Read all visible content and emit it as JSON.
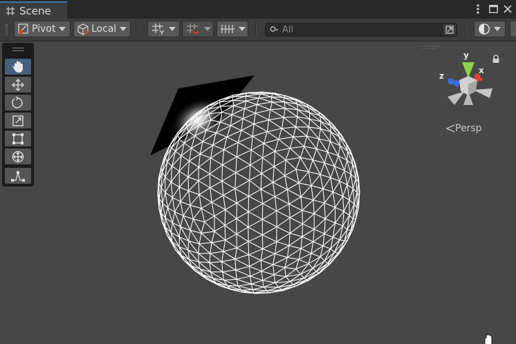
{
  "tab": {
    "title": "Scene",
    "icon": "scene-grid-icon"
  },
  "window_controls": {
    "icons": [
      "more-vertical-icon",
      "maximize-icon",
      "close-icon"
    ]
  },
  "toolbar": {
    "pivot_label": "Pivot",
    "local_label": "Local",
    "search_placeholder": "All",
    "icons": [
      "pivot-icon",
      "local-cube-icon",
      "grid-snap-icon",
      "increment-snap-icon",
      "grid-visibility-icon",
      "search-icon",
      "search-expand-icon",
      "shading-mode-icon"
    ]
  },
  "tools": [
    "hand-tool",
    "move-tool",
    "rotate-tool",
    "scale-tool",
    "rect-tool",
    "transform-tool",
    "custom-editor-tool"
  ],
  "gizmo": {
    "x_label": "x",
    "y_label": "y",
    "z_label": "z",
    "projection_label": "Persp",
    "colors": {
      "x": "#e0402f",
      "y": "#8fd04a",
      "z": "#3f6ee0"
    }
  },
  "colors": {
    "tab_accent": "#3a79bb",
    "viewport_bg": "#474747",
    "wireframe": "#ffffff"
  }
}
